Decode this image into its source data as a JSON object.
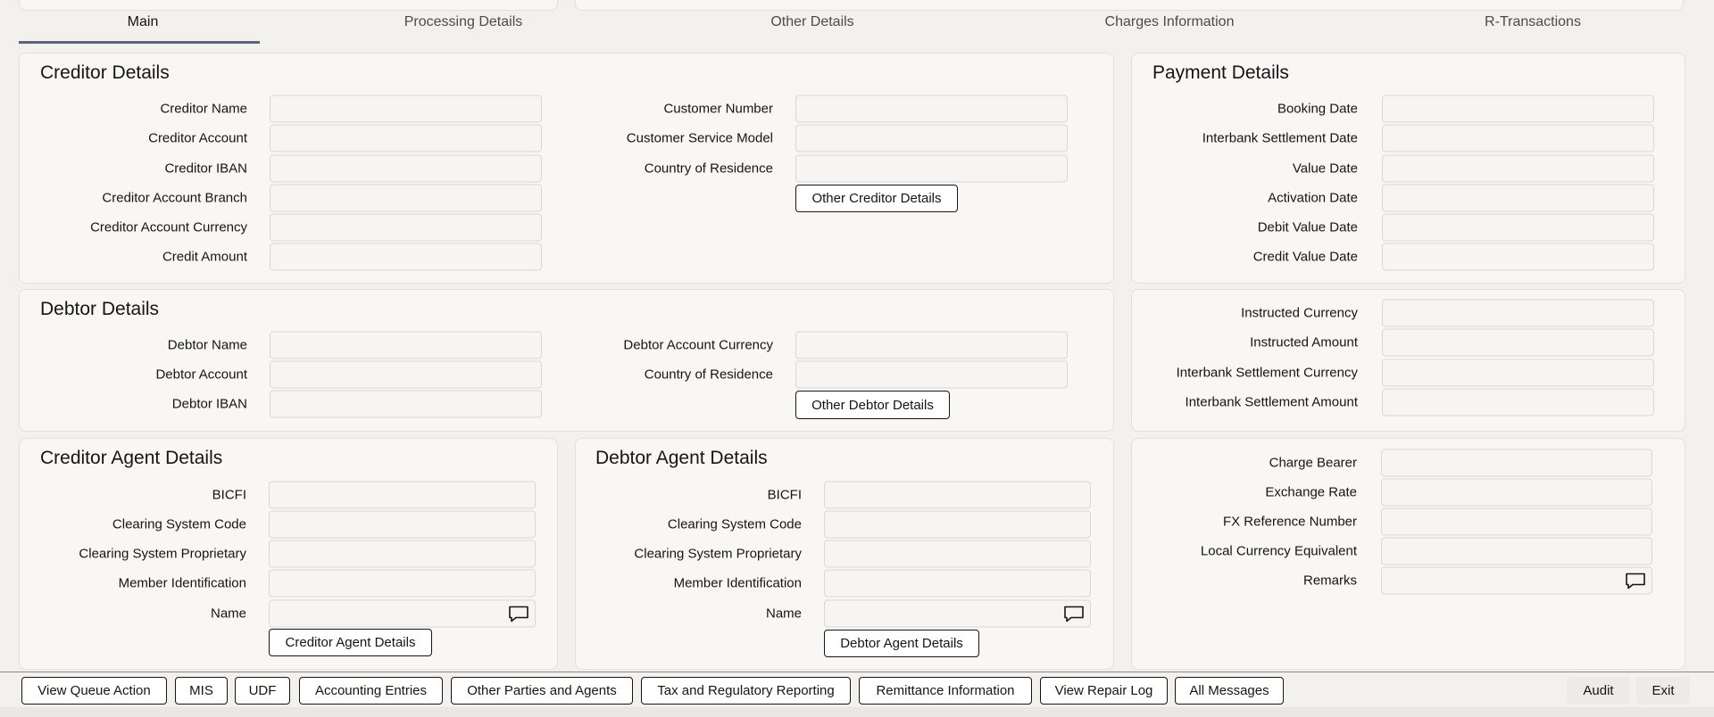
{
  "tabs": [
    "Main",
    "Processing Details",
    "Other Details",
    "Charges Information",
    "R-Transactions"
  ],
  "creditor_details": {
    "title": "Creditor Details",
    "left_fields": [
      {
        "label": "Creditor Name",
        "value": ""
      },
      {
        "label": "Creditor Account",
        "value": ""
      },
      {
        "label": "Creditor IBAN",
        "value": ""
      },
      {
        "label": "Creditor Account Branch",
        "value": ""
      },
      {
        "label": "Creditor Account Currency",
        "value": ""
      },
      {
        "label": "Credit Amount",
        "value": ""
      }
    ],
    "right_fields": [
      {
        "label": "Customer Number",
        "value": ""
      },
      {
        "label": "Customer Service Model",
        "value": ""
      },
      {
        "label": "Country of Residence",
        "value": ""
      }
    ],
    "button": "Other Creditor Details"
  },
  "payment_details": {
    "title": "Payment Details",
    "fields": [
      {
        "label": "Booking Date",
        "value": ""
      },
      {
        "label": "Interbank Settlement Date",
        "value": ""
      },
      {
        "label": "Value Date",
        "value": ""
      },
      {
        "label": "Activation Date",
        "value": ""
      },
      {
        "label": "Debit Value Date",
        "value": ""
      },
      {
        "label": "Credit Value Date",
        "value": ""
      }
    ]
  },
  "debtor_details": {
    "title": "Debtor Details",
    "left_fields": [
      {
        "label": "Debtor Name",
        "value": ""
      },
      {
        "label": "Debtor Account",
        "value": ""
      },
      {
        "label": "Debtor IBAN",
        "value": ""
      }
    ],
    "right_fields": [
      {
        "label": "Debtor Account Currency",
        "value": ""
      },
      {
        "label": "Country of Residence",
        "value": ""
      }
    ],
    "button": "Other Debtor Details"
  },
  "amount_details": {
    "fields": [
      {
        "label": "Instructed Currency",
        "value": ""
      },
      {
        "label": "Instructed Amount",
        "value": ""
      },
      {
        "label": "Interbank Settlement Currency",
        "value": ""
      },
      {
        "label": "Interbank Settlement Amount",
        "value": ""
      }
    ]
  },
  "creditor_agent": {
    "title": "Creditor Agent Details",
    "fields": [
      {
        "label": "BICFI",
        "value": ""
      },
      {
        "label": "Clearing System Code",
        "value": ""
      },
      {
        "label": "Clearing System Proprietary",
        "value": ""
      },
      {
        "label": "Member Identification",
        "value": ""
      },
      {
        "label": "Name",
        "value": ""
      }
    ],
    "button": "Creditor Agent Details"
  },
  "debtor_agent": {
    "title": "Debtor Agent Details",
    "fields": [
      {
        "label": "BICFI",
        "value": ""
      },
      {
        "label": "Clearing System Code",
        "value": ""
      },
      {
        "label": "Clearing System Proprietary",
        "value": ""
      },
      {
        "label": "Member Identification",
        "value": ""
      },
      {
        "label": "Name",
        "value": ""
      }
    ],
    "button": "Debtor Agent Details"
  },
  "charges": {
    "fields": [
      {
        "label": "Charge Bearer",
        "value": ""
      },
      {
        "label": "Exchange Rate",
        "value": ""
      },
      {
        "label": "FX Reference Number",
        "value": ""
      },
      {
        "label": "Local Currency Equivalent",
        "value": ""
      },
      {
        "label": "Remarks",
        "value": ""
      }
    ]
  },
  "toolbar": {
    "buttons": [
      "View Queue Action",
      "MIS",
      "UDF",
      "Accounting Entries",
      "Other Parties and Agents",
      "Tax and Regulatory Reporting",
      "Remittance Information",
      "View Repair Log",
      "All Messages"
    ],
    "audit": "Audit",
    "exit": "Exit"
  },
  "icons": {
    "remarks": "chat-bubble-icon"
  }
}
